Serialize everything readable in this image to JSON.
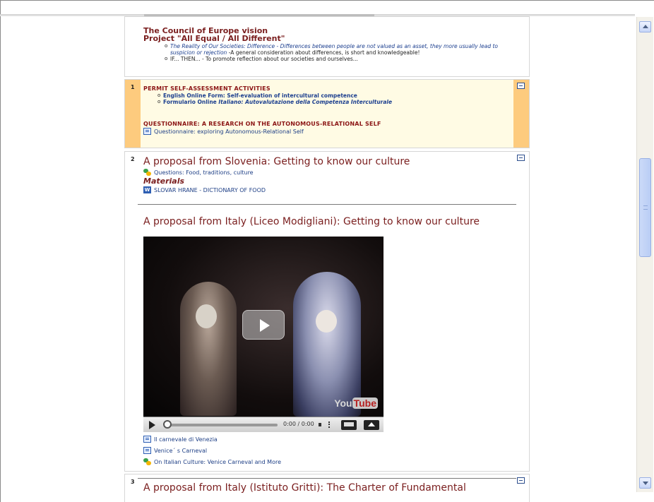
{
  "section0": {
    "title1": "The Council of Europe vision",
    "title2": "Project \"All Equal / All Different\"",
    "items": [
      {
        "italic": "The Reality of Our Societies: Difference - Differences between people are not valued as an asset, they more usually lead to suspicion or rejection",
        "rest": " -A general consideration about differences, is short and knowledgeable!"
      },
      {
        "italic": "",
        "rest": "IF... THEN... - To promote reflection about our societies and ourselves..."
      }
    ]
  },
  "section1": {
    "number": "1",
    "heading": "PERMIT SELF-ASSESSMENT ACTIVITIES",
    "items": [
      {
        "text": "English Online Form: Self-evaluation of intercultural competence"
      },
      {
        "prefix": "Formulario Online ",
        "italic": "Italiano: Autovalutazione della Competenza Interculturale"
      }
    ],
    "heading2": "QUESTIONNAIRE: A RESEARCH ON THE AUTONOMOUS-RELATIONAL SELF",
    "activity": "Questionnaire: exploring Autonomous-Relational Self"
  },
  "section2": {
    "number": "2",
    "title": "A proposal from Slovenia: Getting to know our culture",
    "forum1": "Questions: Food, traditions, culture",
    "materials_label": "Materials",
    "file1": "SLOVAR HRANE - DICTIONARY OF FOOD",
    "title2": "A proposal from Italy (Liceo Modigliani): Getting to know our culture",
    "video": {
      "time": "0:00 / 0:00",
      "logo_you": "You",
      "logo_tube": "Tube"
    },
    "links": [
      "Il carnevale di Venezia",
      "Venice´ s Carneval"
    ],
    "forum2": "On Italian Culture: Venice Carneval and More"
  },
  "section3": {
    "number": "3",
    "title": "A proposal from Italy (Istituto Gritti): The Charter of Fundamental"
  }
}
